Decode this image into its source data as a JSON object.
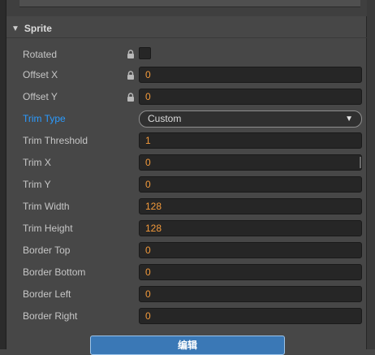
{
  "section": {
    "title": "Sprite"
  },
  "rows": [
    {
      "label": "Rotated",
      "type": "checkbox"
    },
    {
      "label": "Offset X",
      "type": "number",
      "value": "0"
    },
    {
      "label": "Offset Y",
      "type": "number",
      "value": "0"
    },
    {
      "label": "Trim Type",
      "type": "select",
      "value": "Custom"
    },
    {
      "label": "Trim Threshold",
      "type": "number",
      "value": "1"
    },
    {
      "label": "Trim X",
      "type": "number",
      "value": "0"
    },
    {
      "label": "Trim Y",
      "type": "number",
      "value": "0"
    },
    {
      "label": "Trim Width",
      "type": "number",
      "value": "128"
    },
    {
      "label": "Trim Height",
      "type": "number",
      "value": "128"
    },
    {
      "label": "Border Top",
      "type": "number",
      "value": "0"
    },
    {
      "label": "Border Bottom",
      "type": "number",
      "value": "0"
    },
    {
      "label": "Border Left",
      "type": "number",
      "value": "0"
    },
    {
      "label": "Border Right",
      "type": "number",
      "value": "0"
    }
  ],
  "edit_button": {
    "label": "编辑"
  },
  "colors": {
    "accent": "#2b9bff",
    "value_text": "#f39a3b",
    "button": "#3a78b6"
  },
  "icons": {
    "lock": "lock-icon",
    "caret": "chevron-down-icon",
    "select_arrow": "triangle-down-icon"
  }
}
